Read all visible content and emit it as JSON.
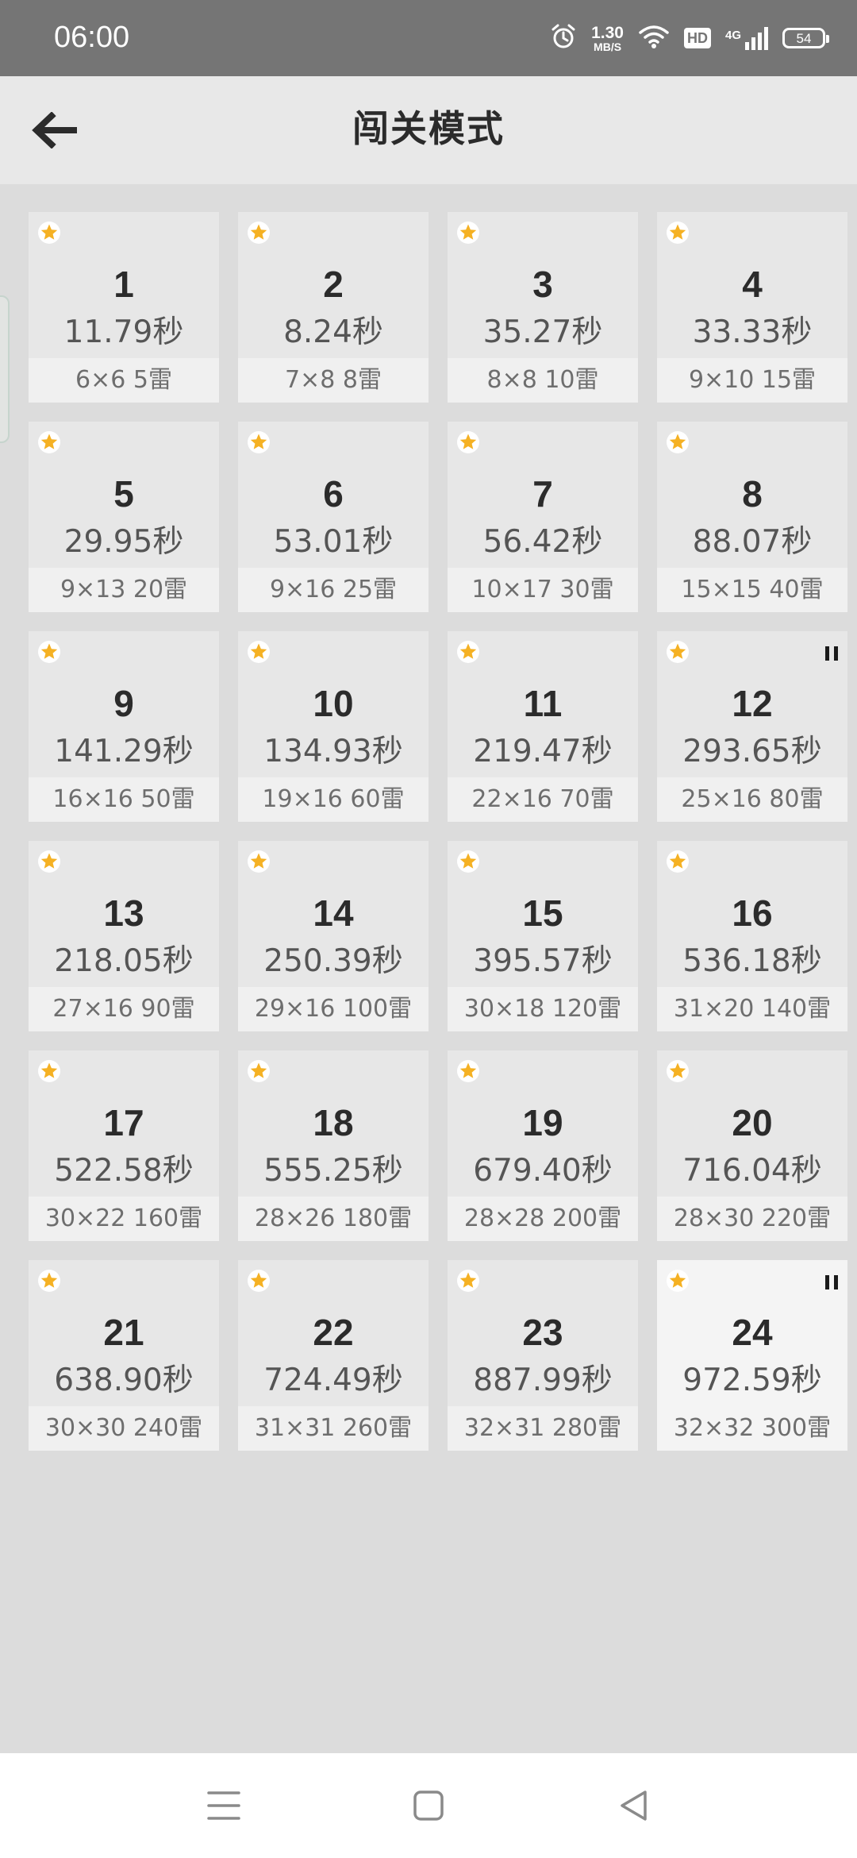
{
  "status_bar": {
    "time": "06:00",
    "net_speed_value": "1.30",
    "net_speed_unit": "MB/S",
    "hd_label": "HD",
    "network_type": "4G",
    "battery_level": "54"
  },
  "header": {
    "title": "闯关模式"
  },
  "colors": {
    "star": "#f5b123",
    "card_background": "#e7e7e7",
    "card_selected_background": "#f4f4f4"
  },
  "levels": [
    {
      "number": "1",
      "time": "11.79秒",
      "config": "6×6  5雷",
      "star": true,
      "paused": false,
      "selected": false
    },
    {
      "number": "2",
      "time": "8.24秒",
      "config": "7×8  8雷",
      "star": true,
      "paused": false,
      "selected": false
    },
    {
      "number": "3",
      "time": "35.27秒",
      "config": "8×8  10雷",
      "star": true,
      "paused": false,
      "selected": false
    },
    {
      "number": "4",
      "time": "33.33秒",
      "config": "9×10  15雷",
      "star": true,
      "paused": false,
      "selected": false
    },
    {
      "number": "5",
      "time": "29.95秒",
      "config": "9×13  20雷",
      "star": true,
      "paused": false,
      "selected": false
    },
    {
      "number": "6",
      "time": "53.01秒",
      "config": "9×16  25雷",
      "star": true,
      "paused": false,
      "selected": false
    },
    {
      "number": "7",
      "time": "56.42秒",
      "config": "10×17  30雷",
      "star": true,
      "paused": false,
      "selected": false
    },
    {
      "number": "8",
      "time": "88.07秒",
      "config": "15×15  40雷",
      "star": true,
      "paused": false,
      "selected": false
    },
    {
      "number": "9",
      "time": "141.29秒",
      "config": "16×16  50雷",
      "star": true,
      "paused": false,
      "selected": false
    },
    {
      "number": "10",
      "time": "134.93秒",
      "config": "19×16  60雷",
      "star": true,
      "paused": false,
      "selected": false
    },
    {
      "number": "11",
      "time": "219.47秒",
      "config": "22×16  70雷",
      "star": true,
      "paused": false,
      "selected": false
    },
    {
      "number": "12",
      "time": "293.65秒",
      "config": "25×16  80雷",
      "star": true,
      "paused": true,
      "selected": false
    },
    {
      "number": "13",
      "time": "218.05秒",
      "config": "27×16  90雷",
      "star": true,
      "paused": false,
      "selected": false
    },
    {
      "number": "14",
      "time": "250.39秒",
      "config": "29×16  100雷",
      "star": true,
      "paused": false,
      "selected": false
    },
    {
      "number": "15",
      "time": "395.57秒",
      "config": "30×18  120雷",
      "star": true,
      "paused": false,
      "selected": false
    },
    {
      "number": "16",
      "time": "536.18秒",
      "config": "31×20  140雷",
      "star": true,
      "paused": false,
      "selected": false
    },
    {
      "number": "17",
      "time": "522.58秒",
      "config": "30×22  160雷",
      "star": true,
      "paused": false,
      "selected": false
    },
    {
      "number": "18",
      "time": "555.25秒",
      "config": "28×26  180雷",
      "star": true,
      "paused": false,
      "selected": false
    },
    {
      "number": "19",
      "time": "679.40秒",
      "config": "28×28  200雷",
      "star": true,
      "paused": false,
      "selected": false
    },
    {
      "number": "20",
      "time": "716.04秒",
      "config": "28×30  220雷",
      "star": true,
      "paused": false,
      "selected": false
    },
    {
      "number": "21",
      "time": "638.90秒",
      "config": "30×30  240雷",
      "star": true,
      "paused": false,
      "selected": false
    },
    {
      "number": "22",
      "time": "724.49秒",
      "config": "31×31  260雷",
      "star": true,
      "paused": false,
      "selected": false
    },
    {
      "number": "23",
      "time": "887.99秒",
      "config": "32×31  280雷",
      "star": true,
      "paused": false,
      "selected": false
    },
    {
      "number": "24",
      "time": "972.59秒",
      "config": "32×32  300雷",
      "star": true,
      "paused": true,
      "selected": true
    }
  ],
  "nav_bar": {
    "icons": [
      "menu-icon",
      "home-icon",
      "back-triangle-icon"
    ]
  }
}
